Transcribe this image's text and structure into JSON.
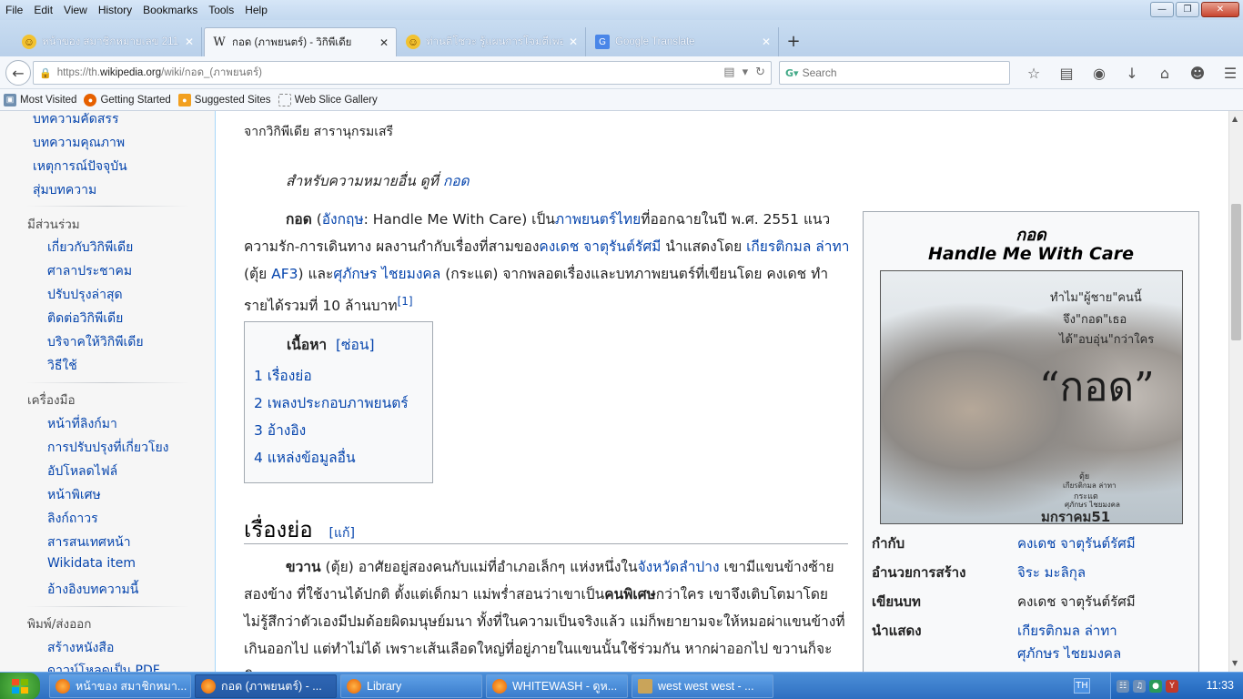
{
  "menu": [
    "File",
    "Edit",
    "View",
    "History",
    "Bookmarks",
    "Tools",
    "Help"
  ],
  "tabs": [
    {
      "title": "หน้าของ สมาชิกหมายเลข 211...",
      "icon": "smiley-icon",
      "active": false
    },
    {
      "title": "กอด (ภาพยนตร์) - วิกิพีเดีย",
      "icon": "wikipedia-icon",
      "active": true
    },
    {
      "title": "ท่านติโชวะ รู้แผนการโจมตีเพอ...",
      "icon": "smiley-icon",
      "active": false
    },
    {
      "title": "Google Translate",
      "icon": "translate-icon",
      "active": false
    }
  ],
  "address": {
    "prefix": "https://th.",
    "domain": "wikipedia.org",
    "path": "/wiki/กอด_(ภาพยนตร์)"
  },
  "search": {
    "placeholder": "Search"
  },
  "bookmarks": [
    "Most Visited",
    "Getting Started",
    "Suggested Sites",
    "Web Slice Gallery"
  ],
  "sidebar": {
    "nav_items": [
      "บทความคัดสรร",
      "บทความคุณภาพ",
      "เหตุการณ์ปัจจุบัน",
      "สุ่มบทความ"
    ],
    "participate": {
      "heading": "มีส่วนร่วม",
      "items": [
        "เกี่ยวกับวิกิพีเดีย",
        "ศาลาประชาคม",
        "ปรับปรุงล่าสุด",
        "ติดต่อวิกิพีเดีย",
        "บริจาคให้วิกิพีเดีย",
        "วิธีใช้"
      ]
    },
    "tools": {
      "heading": "เครื่องมือ",
      "items": [
        "หน้าที่ลิงก์มา",
        "การปรับปรุงที่เกี่ยวโยง",
        "อัปโหลดไฟล์",
        "หน้าพิเศษ",
        "ลิงก์ถาวร",
        "สารสนเทศหน้า",
        "Wikidata item",
        "อ้างอิงบทความนี้"
      ]
    },
    "print": {
      "heading": "พิมพ์/ส่งออก",
      "items": [
        "สร้างหนังสือ",
        "ดาวน์โหลดเป็น PDF"
      ]
    }
  },
  "article": {
    "from": "จากวิกิพีเดีย สารานุกรมเสรี",
    "hatnote_prefix": "สำหรับความหมายอื่น ดูที่ ",
    "hatnote_link": "กอด",
    "intro": {
      "bold": "กอด",
      "p1": " (",
      "l1": "อังกฤษ",
      "p2": ": Handle Me With Care) เป็น",
      "l2": "ภาพยนตร์ไทย",
      "p3": "ที่ออกฉายในปี พ.ศ. 2551 แนวความรัก-การเดินทาง ผลงานกำกับเรื่องที่สามของ",
      "l3": "คงเดช จาตุรันต์รัศมี",
      "p4": " นำแสดงโดย ",
      "l4": "เกียรติกมล ล่าทา",
      "p5": " (ตุ้ย ",
      "l5": "AF3",
      "p6": ") และ",
      "l6": "ศุภักษร ไชยมงคล",
      "p7": " (กระแต) จากพลอตเรื่องและบทภาพยนตร์ที่เขียนโดย คงเดช ทำรายได้รวมที่ 10 ล้านบาท",
      "ref": "[1]"
    },
    "toc": {
      "title": "เนื้อหา",
      "toggle": "[ซ่อน]",
      "items": [
        "1 เรื่องย่อ",
        "2 เพลงประกอบภาพยนตร์",
        "3 อ้างอิง",
        "4 แหล่งข้อมูลอื่น"
      ]
    },
    "section": {
      "title": "เรื่องย่อ",
      "edit": "[แก้]"
    },
    "plot": {
      "bold1": "ขวาน",
      "t1": " (ตุ้ย) อาศัยอยู่สองคนกับแม่ที่อำเภอเล็กๆ แห่งหนึ่งใน",
      "l1": "จังหวัดลำปาง",
      "t2": " เขามีแขนข้างซ้ายสองข้าง ที่ใช้งานได้ปกติ ตั้งแต่เด็กมา แม่พร่ำสอนว่าเขาเป็น",
      "bold2": "คนพิเศษ",
      "t3": "กว่าใคร เขาจึงเติบโตมาโดยไม่รู้สึกว่าตัวเองมีปมด้อยผิดมนุษย์มนา ทั้งที่ในความเป็นจริงแล้ว แม่ก็พยายามจะให้หมอผ่าแขนข้างที่เกินออกไป แต่ทำไม่ได้ เพราะเส้นเลือดใหญ่ที่อยู่ภายในแขนนั้นใช้ร่วมกัน หากผ่าออกไป ขวานก็จะพิการ"
    }
  },
  "infobox": {
    "title_th": "กอด",
    "title_en": "Handle Me With Care",
    "poster": {
      "tagline1": "ทำไม\"ผู้ชาย\"คนนี้",
      "tagline2": "จึง\"กอด\"เธอ",
      "tagline3": "ได้\"อบอุ่น\"กว่าใคร",
      "big_title": "“กอด”",
      "cast1": "ตุ้ย",
      "cast2": "เกียรติกมล ล่าทา",
      "cast3": "กระแต",
      "cast4": "ศุภักษร ไชยมงคล",
      "release": "มกราคม51"
    },
    "rows": [
      {
        "label": "กำกับ",
        "value": "คงเดช จาตุรันต์รัศมี",
        "link": true
      },
      {
        "label": "อำนวยการสร้าง",
        "value": "จิระ มะลิกุล",
        "link": true
      },
      {
        "label": "เขียนบท",
        "value": "คงเดช จาตุรันต์รัศมี",
        "link": false
      },
      {
        "label": "นำแสดง",
        "value": "เกียรติกมล ล่าทา",
        "value2": "ศุภักษร ไชยมงคล",
        "link": true
      }
    ]
  },
  "taskbar": {
    "items": [
      {
        "label": "หน้าของ สมาชิกหมา...",
        "active": false
      },
      {
        "label": "กอด (ภาพยนตร์) - ...",
        "active": true
      },
      {
        "label": "Library",
        "active": false
      },
      {
        "label": "WHITEWASH - ดูห...",
        "active": false
      },
      {
        "label": "west  west west - ...",
        "active": false
      }
    ],
    "lang": "TH",
    "clock": "11:33"
  },
  "colors": {
    "link": "#0645ad",
    "taskbar": "#2f6fc1",
    "accent_green": "#2f8b2a"
  }
}
